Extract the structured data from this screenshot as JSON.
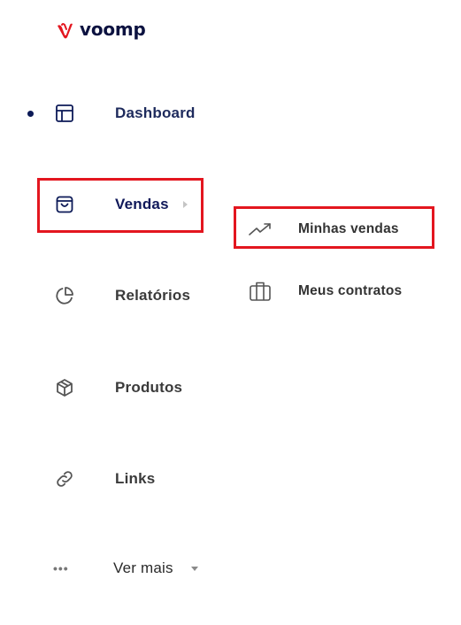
{
  "brand": {
    "name": "voomp",
    "logo_color": "#e3161f",
    "text_color": "#0c1240"
  },
  "sidebar": {
    "items": [
      {
        "id": "dashboard",
        "label": "Dashboard",
        "icon": "layout-icon",
        "active": true
      },
      {
        "id": "vendas",
        "label": "Vendas",
        "icon": "shopping-bag-icon",
        "has_submenu": true
      },
      {
        "id": "relatorios",
        "label": "Relatórios",
        "icon": "pie-chart-icon"
      },
      {
        "id": "produtos",
        "label": "Produtos",
        "icon": "box-icon"
      },
      {
        "id": "links",
        "label": "Links",
        "icon": "link-icon"
      },
      {
        "id": "ver-mais",
        "label": "Ver mais",
        "icon": "more-dots-icon",
        "dropdown": true
      }
    ]
  },
  "submenu": {
    "items": [
      {
        "id": "minhas-vendas",
        "label": "Minhas vendas",
        "icon": "trending-up-icon"
      },
      {
        "id": "meus-contratos",
        "label": "Meus contratos",
        "icon": "briefcase-icon"
      }
    ]
  },
  "colors": {
    "accent_active": "#0c1a57",
    "highlight": "#e3161f",
    "icon": "#555555"
  }
}
